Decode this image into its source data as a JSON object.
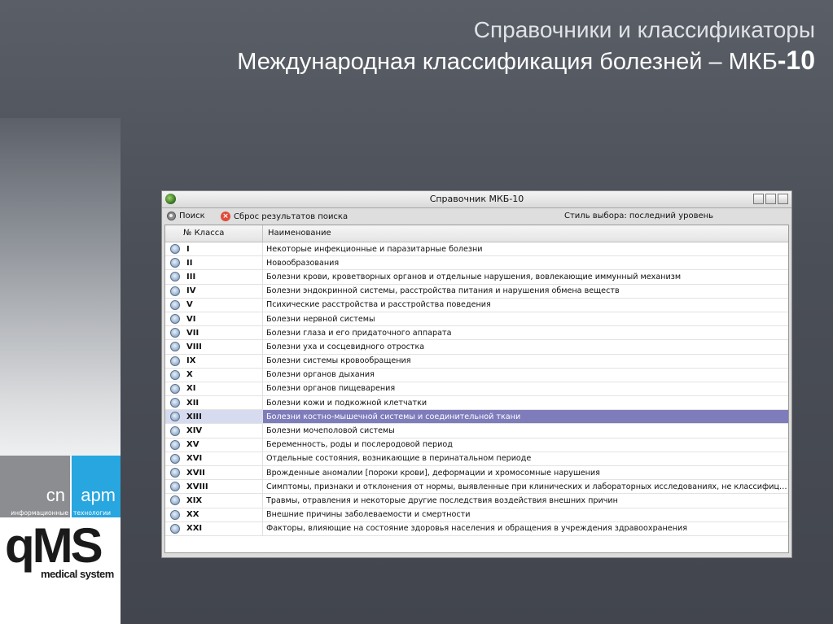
{
  "slide": {
    "title_line1": "Справочники и классификаторы",
    "title_line2_main": "Международная классификация болезней – МКБ",
    "title_line2_suffix": "-10"
  },
  "logos": {
    "cn_big": "cn",
    "cn_small": "информационные",
    "apm_big": "apm",
    "apm_small": "технологии",
    "qms": "qMS",
    "qms_sub": "medical system",
    "colors": {
      "cn_bg": "#8b8d90",
      "apm_bg": "#27a6df"
    }
  },
  "window": {
    "title": "Справочник МКБ-10",
    "toolbar": {
      "search_label": "Поиск",
      "reset_label": "Сброс результатов поиска",
      "style_label": "Стиль выбора: последний уровень"
    },
    "columns": [
      "№ Класса",
      "Наименование"
    ],
    "selected_row_color": "#7e7cbb",
    "rows": [
      {
        "num": "I",
        "name": "Некоторые инфекционные и паразитарные болезни"
      },
      {
        "num": "II",
        "name": "Новообразования"
      },
      {
        "num": "III",
        "name": "Болезни крови, кроветворных органов и отдельные нарушения, вовлекающие иммунный механизм"
      },
      {
        "num": "IV",
        "name": "Болезни эндокринной системы, расстройства питания и нарушения обмена веществ"
      },
      {
        "num": "V",
        "name": "Психические расстройства и расстройства поведения"
      },
      {
        "num": "VI",
        "name": "Болезни нервной системы"
      },
      {
        "num": "VII",
        "name": "Болезни глаза и его придаточного аппарата"
      },
      {
        "num": "VIII",
        "name": "Болезни уха и сосцевидного отростка"
      },
      {
        "num": "IX",
        "name": "Болезни системы кровообращения"
      },
      {
        "num": "X",
        "name": "Болезни органов дыхания"
      },
      {
        "num": "XI",
        "name": "Болезни органов пищеварения"
      },
      {
        "num": "XII",
        "name": "Болезни кожи и подкожной клетчатки"
      },
      {
        "num": "XIII",
        "name": "Болезни костно-мышечной системы и соединительной ткани",
        "selected": true
      },
      {
        "num": "XIV",
        "name": "Болезни мочеполовой системы"
      },
      {
        "num": "XV",
        "name": "Беременность, роды и послеродовой период"
      },
      {
        "num": "XVI",
        "name": "Отдельные состояния, возникающие в перинатальном периоде"
      },
      {
        "num": "XVII",
        "name": "Врожденные аномалии [пороки крови], деформации и хромосомные нарушения"
      },
      {
        "num": "XVIII",
        "name": "Симптомы, признаки и отклонения от нормы, выявленные при клинических и лабораторных исследованиях, не классифицирова..."
      },
      {
        "num": "XIX",
        "name": "Травмы, отравления и некоторые другие последствия воздействия внешних причин"
      },
      {
        "num": "XX",
        "name": "Внешние причины заболеваемости и смертности"
      },
      {
        "num": "XXI",
        "name": "Факторы, влияющие на состояние здоровья населения и обращения в учреждения здравоохранения"
      }
    ]
  }
}
